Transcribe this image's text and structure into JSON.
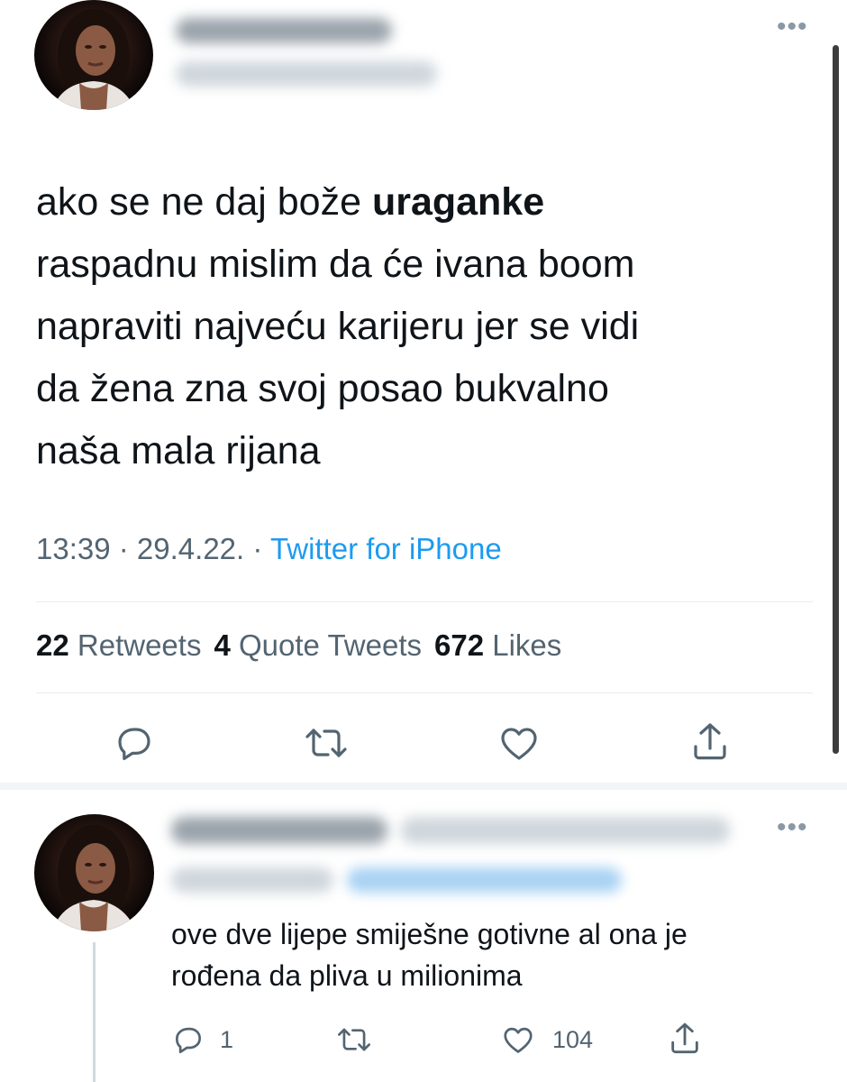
{
  "main_tweet": {
    "text_bold": "uraganke",
    "text_before": "ako se ne daj bože ",
    "text_after": "\nraspadnu mislim da će ivana boom\nnapraviti najveću karijeru jer se vidi\nda žena zna svoj posao bukvalno\nnaša mala rijana",
    "time": "13:39",
    "date": "29.4.22.",
    "source": "Twitter for iPhone",
    "separator": " · ",
    "stats": {
      "retweets_count": "22",
      "retweets_label": "Retweets",
      "quotes_count": "4",
      "quotes_label": "Quote Tweets",
      "likes_count": "672",
      "likes_label": "Likes"
    },
    "more_icon": "•••"
  },
  "reply_tweet": {
    "text": "ove dve lijepe smiješne gotivne al ona je\nrođena da pliva u milionima",
    "reply_count": "1",
    "like_count": "104",
    "more_icon": "•••"
  },
  "icons": {
    "reply": "speech-bubble-icon",
    "retweet": "retweet-icon",
    "like": "heart-icon",
    "share": "share-icon"
  },
  "colors": {
    "link": "#1d9bf0",
    "secondary_text": "#536471",
    "primary_text": "#0f1419"
  }
}
